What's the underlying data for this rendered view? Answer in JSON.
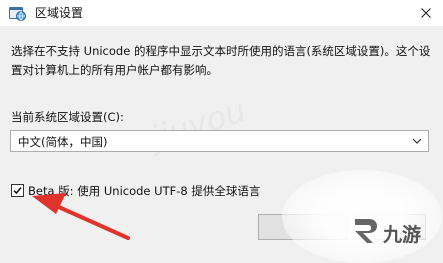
{
  "window": {
    "title": "区域设置",
    "close_glyph": "✕"
  },
  "dialog": {
    "description": "选择在不支持 Unicode 的程序中显示文本时所使用的语言(系统区域设置)。这个设置对计算机上的所有用户帐户都有影响。",
    "locale_label": "当前系统区域设置(C):",
    "locale_select": {
      "value": "中文(简体，中国)"
    },
    "beta_checkbox": {
      "checked": true,
      "label": "Beta 版: 使用 Unicode UTF-8 提供全球语言"
    }
  },
  "overlay": {
    "logo_text": "九游",
    "arrow_color": "#e0332b"
  },
  "icons": {
    "app": "region-globe-icon",
    "close": "close-icon",
    "dropdown": "chevron-down-icon",
    "check": "checkmark-icon"
  }
}
